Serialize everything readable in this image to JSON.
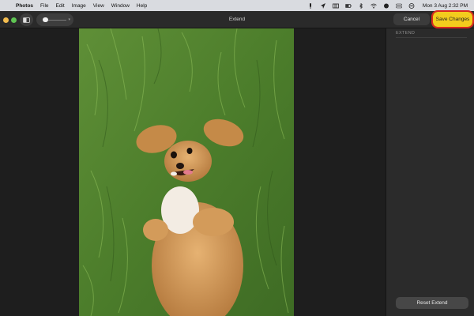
{
  "menubar": {
    "app_name": "Photos",
    "menus": [
      "File",
      "Edit",
      "Image",
      "View",
      "Window",
      "Help"
    ],
    "status_icons": [
      "mic-icon",
      "nav-icon",
      "grid-icon",
      "battery-icon",
      "bluetooth-icon",
      "wifi-icon",
      "globe-icon",
      "controls-icon",
      "user-icon"
    ],
    "clock": "Mon 3 Aug  2:32 PM"
  },
  "toolbar": {
    "title": "Extend",
    "cancel_label": "Cancel",
    "save_label": "Save Changes"
  },
  "inspector": {
    "section_title": "EXTEND",
    "reset_label": "Reset Extend"
  },
  "colors": {
    "accent": "#f3cc1d",
    "highlight": "#d9281e"
  }
}
